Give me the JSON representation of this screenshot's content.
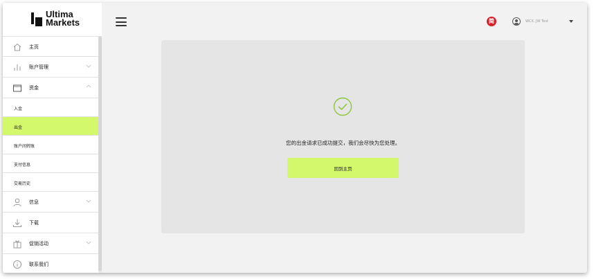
{
  "brand": {
    "line1": "Ultima",
    "line2": "Markets"
  },
  "sidebar": {
    "items": [
      {
        "label": "主页",
        "icon": "home-icon"
      },
      {
        "label": "账户管理",
        "icon": "bar-chart-icon"
      },
      {
        "label": "资金",
        "icon": "wallet-icon"
      },
      {
        "label": "信息",
        "icon": "user-icon"
      },
      {
        "label": "下载",
        "icon": "download-icon"
      },
      {
        "label": "促销活动",
        "icon": "gift-icon"
      },
      {
        "label": "联系我们",
        "icon": "info-icon"
      }
    ],
    "funds_sub": [
      {
        "label": "入金"
      },
      {
        "label": "出金"
      },
      {
        "label": "账户间转账"
      },
      {
        "label": "支付信息"
      },
      {
        "label": "交易历史"
      }
    ]
  },
  "header": {
    "lang_badge": "简",
    "user_name": "WCX. JW Test"
  },
  "main": {
    "message": "您的出金请求已成功提交，我们会尽快为您处理。",
    "button": "回到主页"
  },
  "colors": {
    "accent": "#d4f86c",
    "lang_badge": "#d6202a",
    "panel": "#e5e5e5",
    "success": "#8cc63f"
  }
}
